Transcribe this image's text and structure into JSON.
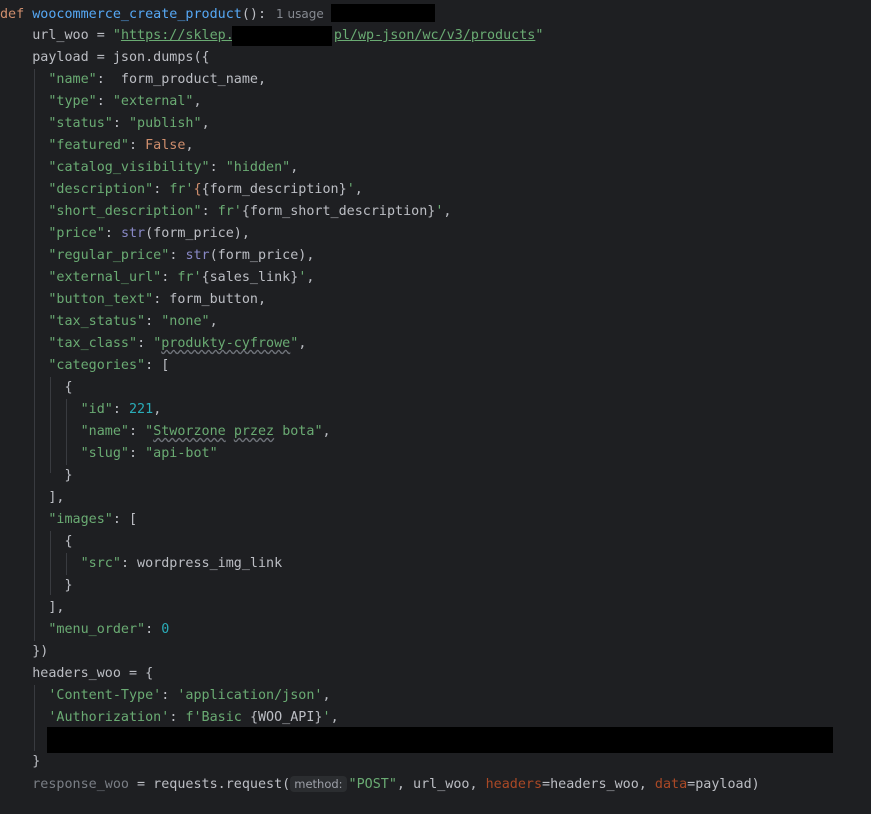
{
  "code": {
    "def_kw": "def",
    "func_name": "woocommerce_create_product",
    "func_tail": "():",
    "usage_hint": "1 usage",
    "url_var": "url_woo = ",
    "url_open": "\"",
    "url_part1": "https://sklep.",
    "url_part2": "pl/wp-json/wc/v3/products",
    "url_close": "\"",
    "payload_head": "payload = json.dumps({",
    "k_name": "\"name\"",
    "v_name": ":  form_product_name,",
    "k_type": "\"type\"",
    "v_type": "\"external\"",
    "k_status": "\"status\"",
    "v_status": "\"publish\"",
    "k_featured": "\"featured\"",
    "v_featured": "False",
    "k_catvis": "\"catalog_visibility\"",
    "v_catvis": "\"hidden\"",
    "k_desc": "\"description\"",
    "v_desc_expr": "{form_description}",
    "k_short": "\"short_description\"",
    "v_short_expr": "{form_short_description}",
    "k_price": "\"price\"",
    "v_price_arg": "(form_price),",
    "k_reg": "\"regular_price\"",
    "v_reg_arg": "(form_price),",
    "k_ext": "\"external_url\"",
    "v_ext_expr": "{sales_link}",
    "k_btn": "\"button_text\"",
    "v_btn": ": form_button,",
    "k_taxs": "\"tax_status\"",
    "v_taxs": "\"none\"",
    "k_taxc": "\"tax_class\"",
    "v_taxc": "produkty-cyfrowe",
    "k_cats": "\"categories\"",
    "k_id": "\"id\"",
    "v_id": "221",
    "k_cname": "\"name\"",
    "v_cname_1": "Stworzone",
    "v_cname_2": "przez",
    "v_cname_3": "bota",
    "k_slug": "\"slug\"",
    "v_slug": "\"api-bot\"",
    "k_images": "\"images\"",
    "k_src": "\"src\"",
    "v_src": ": wordpress_img_link",
    "k_menu": "\"menu_order\"",
    "v_menu": "0",
    "headers_head": "headers_woo = {",
    "k_ct": "'Content-Type'",
    "v_ct": "'application/json'",
    "k_auth": "'Authorization'",
    "v_auth_expr": "{WOO_API}",
    "resp_var": "response_woo",
    "resp_call": " = requests.request(",
    "hint_method": "method:",
    "resp_method": "\"POST\"",
    "resp_url": ", url_woo, ",
    "resp_headers_kw": "headers",
    "resp_headers_val": "=headers_woo, ",
    "resp_data_kw": "data",
    "resp_data_val": "=payload)"
  },
  "colors": {
    "background": "#1e1f22",
    "keyword": "#cf8e6d",
    "function": "#56a8f5",
    "string": "#6aab73",
    "number": "#2aacb8",
    "builtin": "#8888c6",
    "parameter": "#aa4926"
  }
}
